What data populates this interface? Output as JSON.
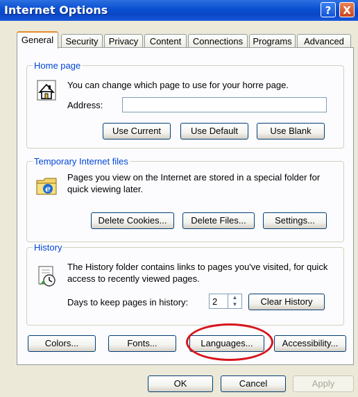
{
  "window": {
    "title": "Internet Options",
    "help_label": "?",
    "close_label": "X"
  },
  "tabs": [
    "General",
    "Security",
    "Privacy",
    "Content",
    "Connections",
    "Programs",
    "Advanced"
  ],
  "home_page": {
    "legend": "Home page",
    "description": "You can change which page to use for your horre page.",
    "address_label": "Address:",
    "address_value": "",
    "buttons": {
      "use_current": "Use Current",
      "use_default": "Use Default",
      "use_blank": "Use Blank"
    },
    "icon": "home-icon"
  },
  "temp_files": {
    "legend": "Temporary Internet files",
    "description": "Pages you view on the Internet are stored in a special folder for quick viewing later.",
    "buttons": {
      "delete_cookies": "Delete Cookies...",
      "delete_files": "Delete Files...",
      "settings": "Settings..."
    },
    "icon": "ie-folder-icon"
  },
  "history": {
    "legend": "History",
    "description": "The History folder contains links to pages you've visited, for quick access to recently viewed pages.",
    "days_label": "Days to keep pages in history:",
    "days_value": "2",
    "clear_button": "Clear History",
    "icon": "history-icon"
  },
  "bottom_buttons": {
    "colors": "Colors...",
    "fonts": "Fonts...",
    "languages": "Languages...",
    "accessibility": "Accessibility..."
  },
  "dialog_buttons": {
    "ok": "OK",
    "cancel": "Cancel",
    "apply": "Apply"
  },
  "annotation": {
    "color": "#d8141b"
  }
}
